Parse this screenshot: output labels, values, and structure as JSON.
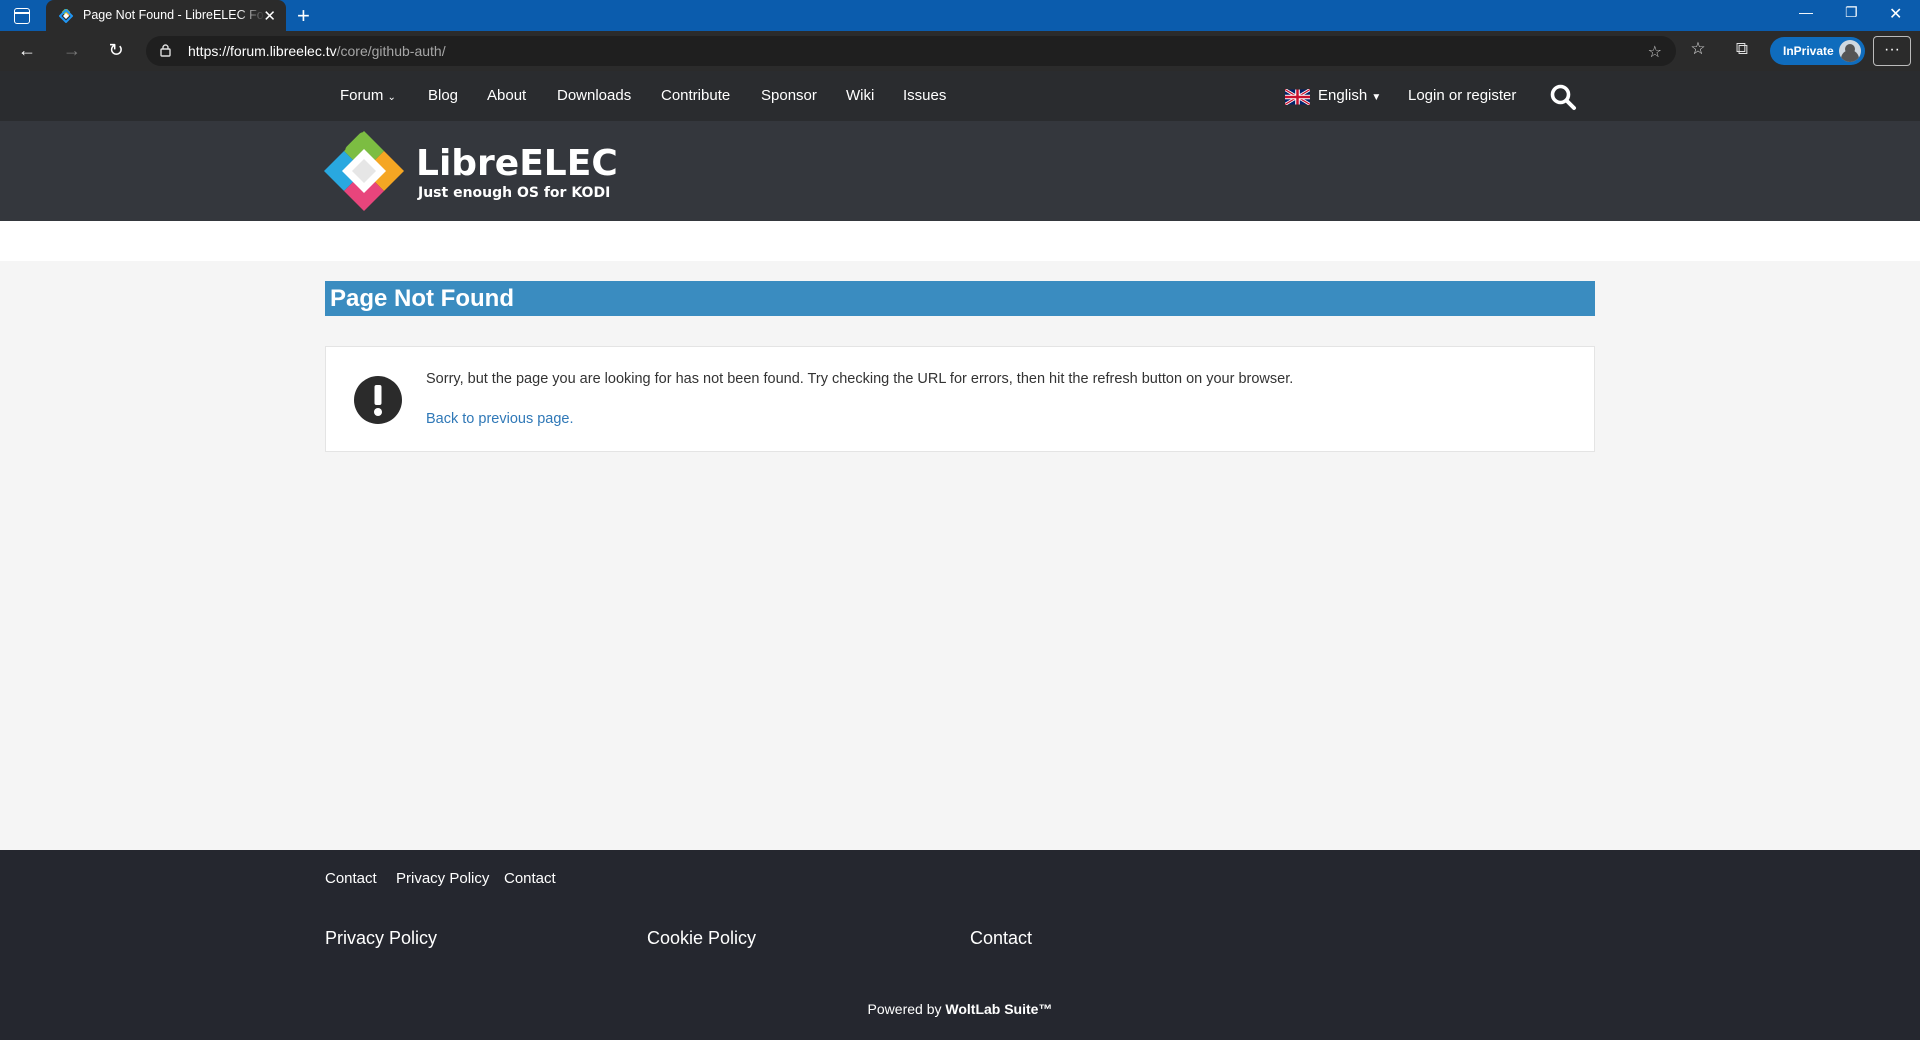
{
  "browser": {
    "tab_title": "Page Not Found - LibreELEC Forum",
    "url_host": "https://forum.libreelec.tv",
    "url_path": "/core/github-auth/",
    "inprivate_label": "InPrivate",
    "more_label": "···"
  },
  "nav": {
    "items": [
      {
        "label": "Forum"
      },
      {
        "label": "Blog"
      },
      {
        "label": "About"
      },
      {
        "label": "Downloads"
      },
      {
        "label": "Contribute"
      },
      {
        "label": "Sponsor"
      },
      {
        "label": "Wiki"
      },
      {
        "label": "Issues"
      }
    ],
    "language": "English",
    "login": "Login or register"
  },
  "logo": {
    "name": "LibreELEC",
    "tagline": "Just enough OS for KODI"
  },
  "main": {
    "title": "Page Not Found",
    "message": "Sorry, but the page you are looking for has not been found. Try checking the URL for errors, then hit the refresh button on your browser.",
    "back_link": "Back to previous page."
  },
  "footer": {
    "small_links": [
      "Contact",
      "Privacy Policy",
      "Contact"
    ],
    "big_links": [
      "Privacy Policy",
      "Cookie Policy",
      "Contact"
    ],
    "powered_prefix": "Powered by ",
    "powered_brand": "WoltLab Suite™"
  },
  "colors": {
    "title_bar": "#0b5cad",
    "page_title_bg": "#3a8cc0",
    "link": "#2f78b7",
    "nav_bg": "#2a2c2f",
    "header_bg": "#34373d",
    "footer_bg": "#25272f"
  }
}
